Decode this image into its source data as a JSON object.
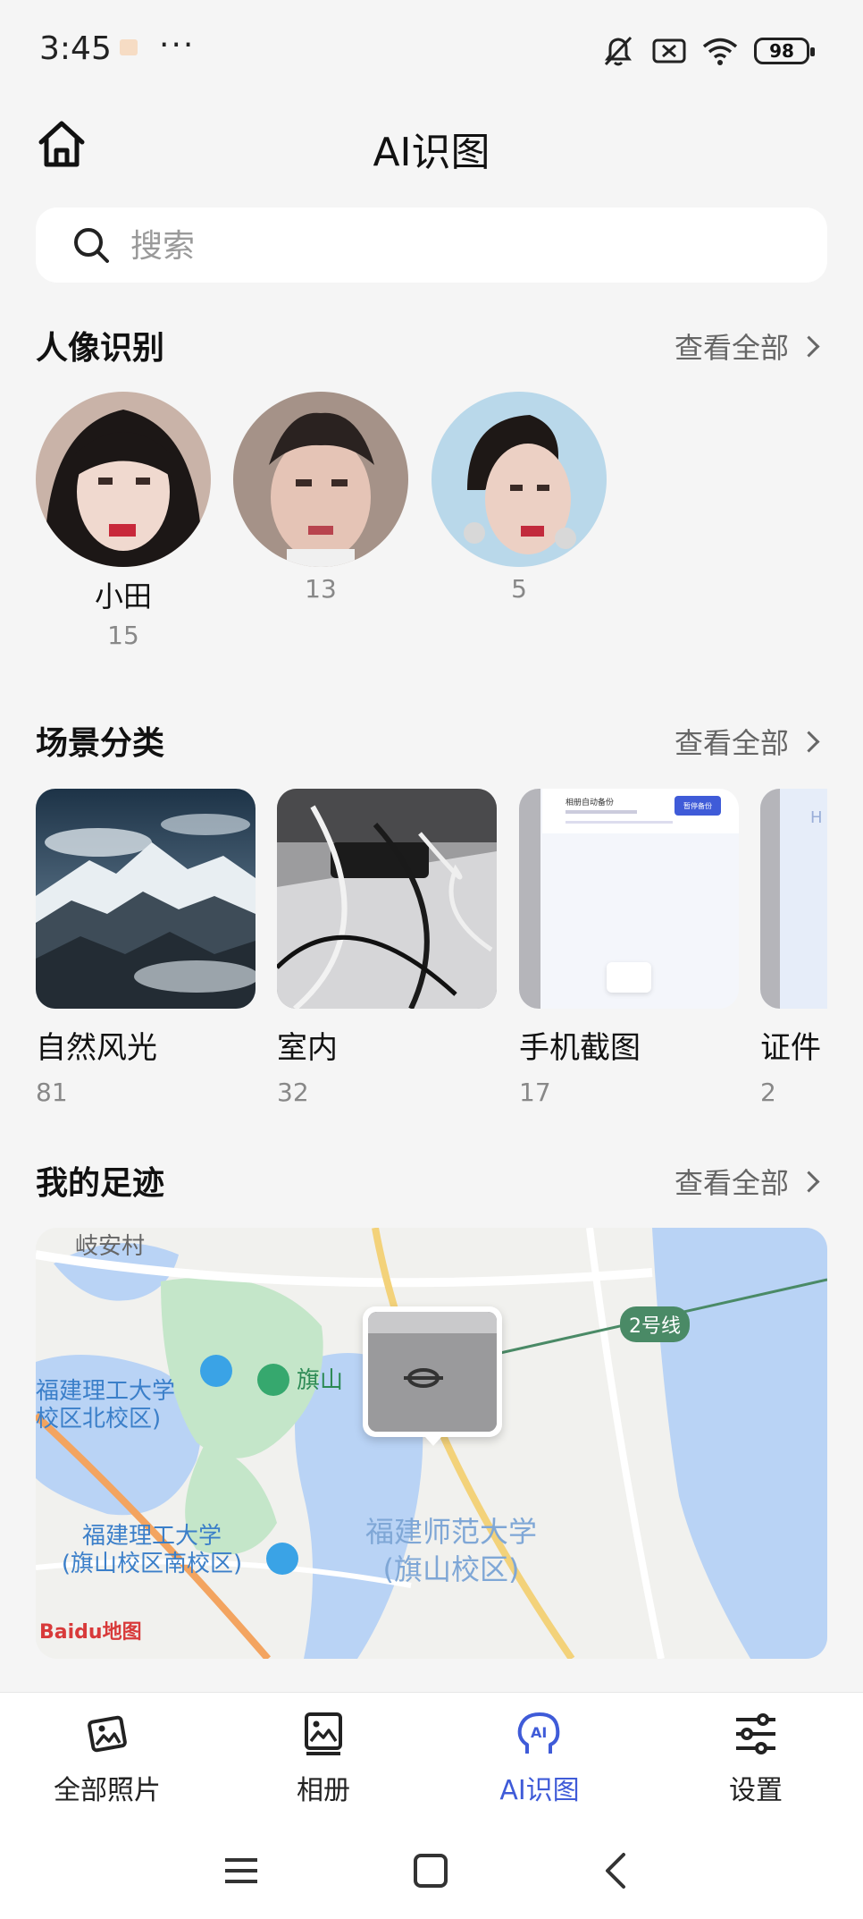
{
  "status_bar": {
    "time": "3:45",
    "more": "···",
    "battery": "98"
  },
  "header": {
    "title": "AI识图"
  },
  "search": {
    "placeholder": "搜索"
  },
  "portrait_section": {
    "title": "人像识别",
    "view_all": "查看全部",
    "people": [
      {
        "name": "小田",
        "count": "15"
      },
      {
        "name": "",
        "count": "13"
      },
      {
        "name": "",
        "count": "5"
      }
    ]
  },
  "scene_section": {
    "title": "场景分类",
    "view_all": "查看全部",
    "scenes": [
      {
        "name": "自然风光",
        "count": "81"
      },
      {
        "name": "室内",
        "count": "32"
      },
      {
        "name": "手机截图",
        "count": "17"
      },
      {
        "name": "证件",
        "count": "2"
      }
    ],
    "screenshot_thumb": {
      "title": "相册自动备份",
      "button": "暂停备份"
    }
  },
  "footprint_section": {
    "title": "我的足迹",
    "view_all": "查看全部",
    "map": {
      "labels": {
        "village": "岐安村",
        "metro": "2号线",
        "qishan": "旗山",
        "fjut_north_1": "福建理工大学",
        "fjut_north_2": "校区北校区)",
        "fjut_south_1": "福建理工大学",
        "fjut_south_2": "(旗山校区南校区)",
        "fjnu_1": "福建师范大学",
        "fjnu_2": "(旗山校区)"
      },
      "logo": "Baidu地图"
    }
  },
  "tab_bar": {
    "tabs": [
      {
        "label": "全部照片"
      },
      {
        "label": "相册"
      },
      {
        "label": "AI识图"
      },
      {
        "label": "设置"
      }
    ]
  },
  "colors": {
    "accent": "#3f5bd8",
    "background": "#f5f5f5",
    "metro_line": "#4a8a66"
  }
}
